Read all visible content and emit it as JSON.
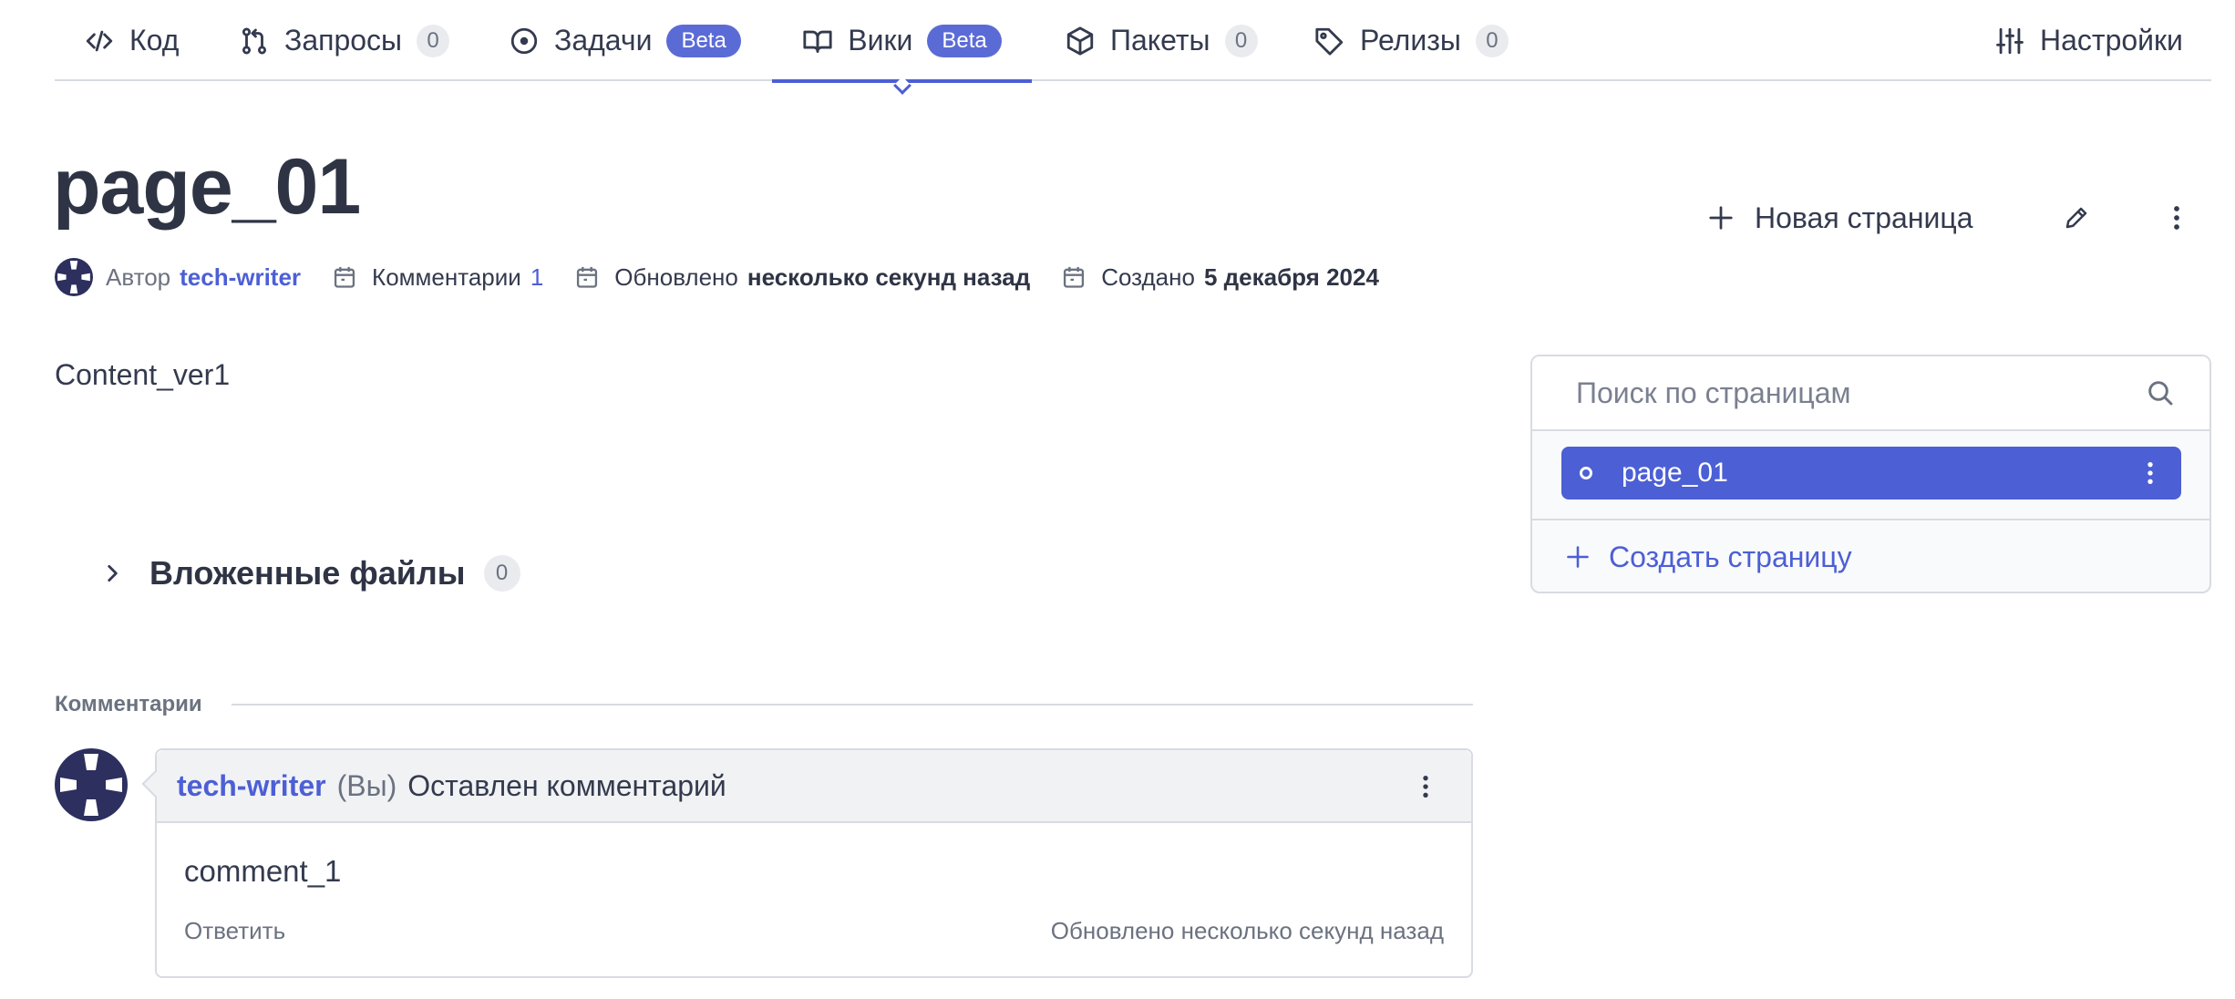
{
  "tabs": [
    {
      "label": "Код",
      "icon": "code-icon"
    },
    {
      "label": "Запросы",
      "count": "0",
      "icon": "pull-request-icon"
    },
    {
      "label": "Задачи",
      "badge": "Beta",
      "icon": "issue-circle-icon"
    },
    {
      "label": "Вики",
      "badge": "Beta",
      "icon": "book-icon",
      "active": true
    },
    {
      "label": "Пакеты",
      "count": "0",
      "icon": "package-icon"
    },
    {
      "label": "Релизы",
      "count": "0",
      "icon": "tag-icon"
    },
    {
      "label": "Настройки",
      "icon": "sliders-icon"
    }
  ],
  "page": {
    "title": "page_01",
    "author_label": "Автор",
    "author": "tech-writer",
    "comments_label": "Комментарии",
    "comments_count": "1",
    "updated_label": "Обновлено",
    "updated_value": "несколько секунд назад",
    "created_label": "Создано",
    "created_value": "5 декабря 2024",
    "content": "Content_ver1"
  },
  "actions": {
    "new_page": "Новая страница"
  },
  "attachments": {
    "title": "Вложенные файлы",
    "count": "0"
  },
  "comments": {
    "header": "Комментарии",
    "items": [
      {
        "author": "tech-writer",
        "you": "(Вы)",
        "action": "Оставлен комментарий",
        "body": "comment_1",
        "reply": "Ответить",
        "updated": "Обновлено несколько секунд назад"
      }
    ]
  },
  "sidebar": {
    "search_placeholder": "Поиск по страницам",
    "pages": [
      "page_01"
    ],
    "create_label": "Создать страницу"
  },
  "colors": {
    "accent": "#4c5fd5",
    "beta_badge": "#5b6bd6",
    "text": "#343a4e",
    "muted": "#6b7280",
    "border": "#d8dbe1"
  }
}
